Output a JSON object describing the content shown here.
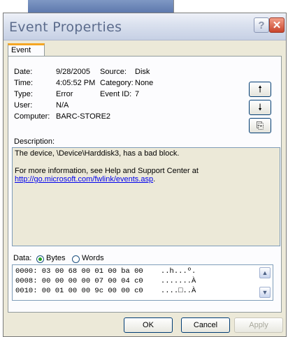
{
  "window": {
    "title": "Event Properties",
    "help_glyph": "?",
    "close_glyph": "✕"
  },
  "tabs": [
    {
      "label": "Event"
    }
  ],
  "event": {
    "date_label": "Date:",
    "date_value": "9/28/2005",
    "source_label": "Source:",
    "source_value": "Disk",
    "time_label": "Time:",
    "time_value": "4:05:52 PM",
    "category_label": "Category:",
    "category_value": "None",
    "type_label": "Type:",
    "type_value": "Error",
    "event_id_label": "Event ID:",
    "event_id_value": "7",
    "user_label": "User:",
    "user_value": "N/A",
    "computer_label": "Computer:",
    "computer_value": "BARC-STORE2"
  },
  "side_buttons": {
    "up_glyph": "🠕",
    "down_glyph": "🠗",
    "copy_glyph": "⎘"
  },
  "description": {
    "label": "Description:",
    "line1": "The device, \\Device\\Harddisk3, has a bad block.",
    "line2": "For more information, see Help and Support Center at",
    "link": "http://go.microsoft.com/fwlink/events.asp",
    "link_tail": "."
  },
  "data": {
    "label": "Data:",
    "bytes_label": "Bytes",
    "words_label": "Words",
    "selected": "Bytes",
    "rows": [
      "0000: 03 00 68 00 01 00 ba 00    ..h...º.",
      "0008: 00 00 00 00 07 00 04 c0    .......À",
      "0010: 00 01 00 00 9c 00 00 c0    ....□..À"
    ],
    "scroll_up_glyph": "▲",
    "scroll_down_glyph": "▼"
  },
  "buttons": {
    "ok": "OK",
    "cancel": "Cancel",
    "apply": "Apply"
  },
  "colors": {
    "dialog_bg": "#ece9d8",
    "title_text": "#5b6b8c",
    "tab_accent": "#f5a623",
    "link": "#0000ee"
  },
  "icons": [
    "help-icon",
    "close-icon",
    "arrow-up-icon",
    "arrow-down-icon",
    "copy-icon"
  ]
}
